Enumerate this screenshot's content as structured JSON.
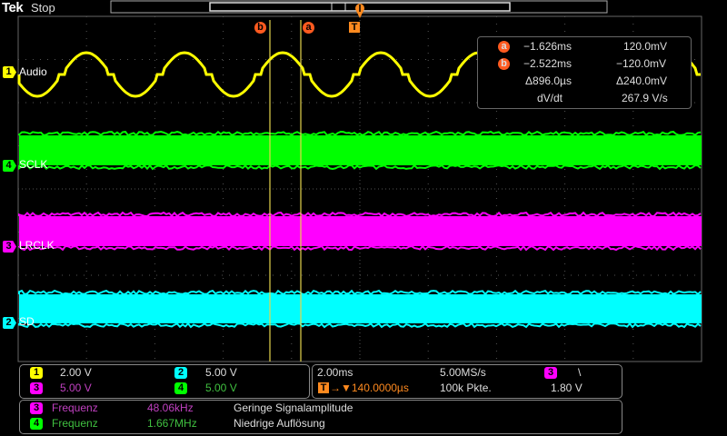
{
  "topbar": {
    "brand": "Tek",
    "state": "Stop"
  },
  "colors": {
    "ch1": "#ffff00",
    "ch2": "#00ffff",
    "ch3": "#ff00ff",
    "ch4": "#00ff00",
    "cursor": "#ff5a1f",
    "trigger": "#ff8a1f",
    "grid": "#555555",
    "cursor_line": "#e6d44c"
  },
  "cursor_markers": {
    "a": "a",
    "b": "b",
    "trigger": "T"
  },
  "channels": [
    {
      "num": "1",
      "label": "Audio"
    },
    {
      "num": "4",
      "label": "SCLK"
    },
    {
      "num": "3",
      "label": "LRCLK"
    },
    {
      "num": "2",
      "label": "SD"
    }
  ],
  "readout": {
    "a_label": "a",
    "a_time": "−1.626ms",
    "a_value": "120.0mV",
    "b_label": "b",
    "b_time": "−2.522ms",
    "b_value": "−120.0mV",
    "delta_time": "Δ896.0µs",
    "delta_value": "Δ240.0mV",
    "dvdt_label": "dV/dt",
    "dvdt_value": "267.9 V/s"
  },
  "vertical_panel": {
    "ch1": {
      "num": "1",
      "scale": "2.00 V"
    },
    "ch2": {
      "num": "2",
      "scale": "5.00 V"
    },
    "ch3": {
      "num": "3",
      "scale": "5.00 V"
    },
    "ch4": {
      "num": "4",
      "scale": "5.00 V"
    }
  },
  "horizontal_panel": {
    "timebase": "2.00ms",
    "sample_rate": "5.00MS/s",
    "trigger_icon": "T",
    "trigger_position": "→▼140.0000µs",
    "record_length": "100k Pkte.",
    "trigger_source": "3",
    "trigger_slope": "\\",
    "trigger_level": "1.80 V"
  },
  "measurements": [
    {
      "num": "3",
      "name": "Frequenz",
      "value": "48.06kHz",
      "note": "Geringe Signalamplitude"
    },
    {
      "num": "4",
      "name": "Frequenz",
      "value": "1.667MHz",
      "note": "Niedrige Auflösung"
    }
  ],
  "icons": {
    "ch3_level_marker": "triangle-left-icon",
    "trigger_pointer": "trigger-arrow-icon"
  }
}
